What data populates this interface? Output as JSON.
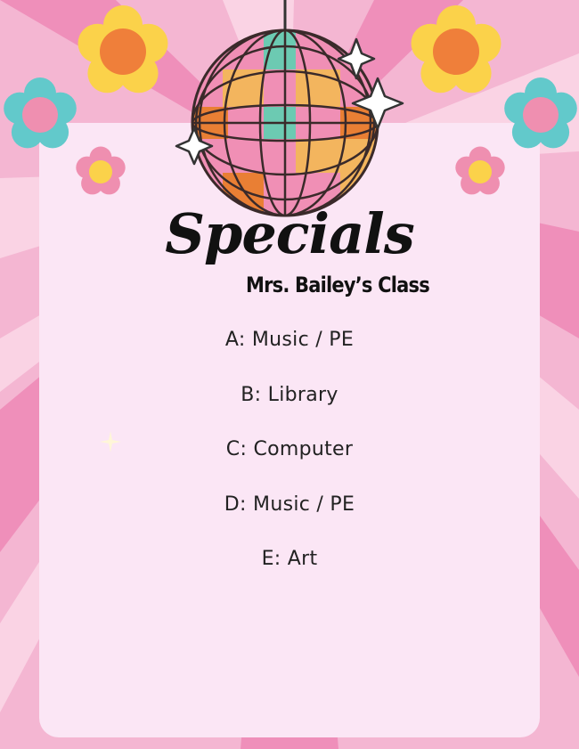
{
  "title": "Specials",
  "subtitle": "Mrs. Bailey’s Class",
  "schedule": [
    "A: Music / PE",
    "B: Library",
    "C: Computer",
    "D: Music / PE",
    "E: Art"
  ],
  "colors": {
    "background": "#f4b6d2",
    "card": "#fbe6f5",
    "ray_dark": "#ef8fba",
    "ray_light": "#fad3e4",
    "flower_yellow": "#fbd24a",
    "flower_orange": "#ef7f3a",
    "flower_teal": "#62c9cb",
    "flower_pink": "#ef8fb0",
    "disco_pink": "#f08fb5",
    "disco_orange": "#e97f34",
    "disco_gold": "#f3b55e",
    "disco_teal": "#6ccab2",
    "text": "#111111"
  },
  "decorations": [
    "disco-ball",
    "yellow-flower",
    "teal-flower",
    "pink-flower",
    "sparkle"
  ]
}
